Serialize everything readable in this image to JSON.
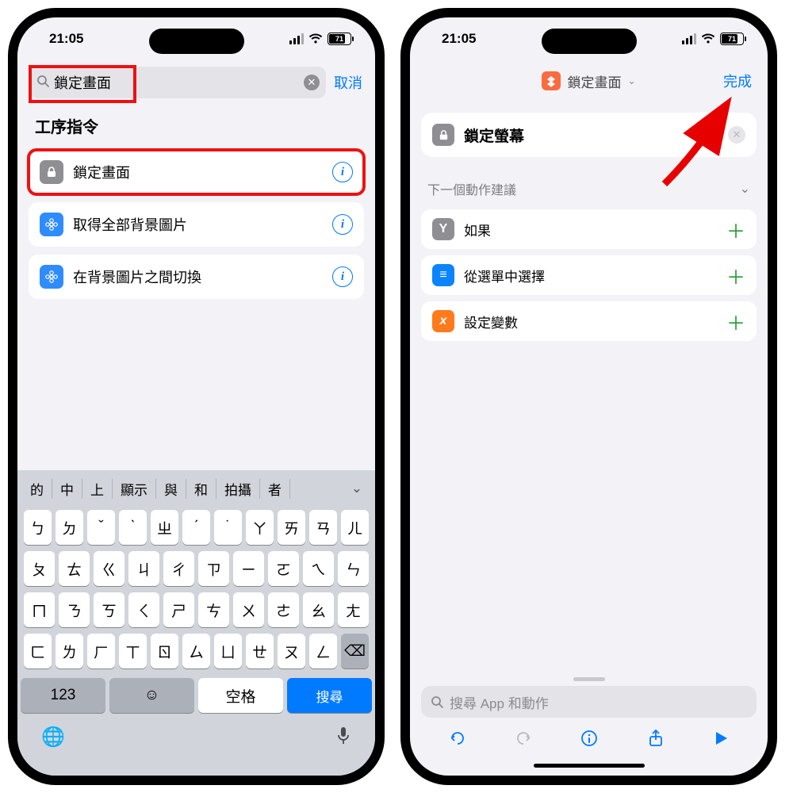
{
  "status": {
    "time": "21:05",
    "battery": "71"
  },
  "left": {
    "search_value": "鎖定畫面",
    "cancel": "取消",
    "section_title": "工序指令",
    "results": [
      {
        "label": "鎖定畫面",
        "icon": "lock-icon",
        "icon_bg": "#8e8e93",
        "highlight": true
      },
      {
        "label": "取得全部背景圖片",
        "icon": "flower-icon",
        "icon_bg": "#2f8cff",
        "highlight": false
      },
      {
        "label": "在背景圖片之間切換",
        "icon": "flower-icon",
        "icon_bg": "#2f8cff",
        "highlight": false
      }
    ],
    "keyboard": {
      "suggestions": [
        "的",
        "中",
        "上",
        "顯示",
        "與",
        "和",
        "拍攝",
        "者"
      ],
      "rows": [
        [
          "ㄅ",
          "ㄉ",
          "ˇ",
          "ˋ",
          "ㄓ",
          "ˊ",
          "˙",
          "ㄚ",
          "ㄞ",
          "ㄢ",
          "ㄦ"
        ],
        [
          "ㄆ",
          "ㄊ",
          "ㄍ",
          "ㄐ",
          "ㄔ",
          "ㄗ",
          "ㄧ",
          "ㄛ",
          "ㄟ",
          "ㄣ"
        ],
        [
          "ㄇ",
          "ㄋ",
          "ㄎ",
          "ㄑ",
          "ㄕ",
          "ㄘ",
          "ㄨ",
          "ㄜ",
          "ㄠ",
          "ㄤ"
        ],
        [
          "ㄈ",
          "ㄌ",
          "ㄏ",
          "ㄒ",
          "ㄖ",
          "ㄙ",
          "ㄩ",
          "ㄝ",
          "ㄡ",
          "ㄥ",
          "⌫"
        ]
      ],
      "key_123": "123",
      "space": "空格",
      "search": "搜尋"
    }
  },
  "right": {
    "title": "鎖定畫面",
    "done": "完成",
    "action_label": "鎖定螢幕",
    "suggestion_header": "下一個動作建議",
    "suggestions": [
      {
        "label": "如果",
        "icon_bg": "#8e8e93",
        "icon_txt": "Y"
      },
      {
        "label": "從選單中選擇",
        "icon_bg": "#0a84ff",
        "icon_txt": "≡"
      },
      {
        "label": "設定變數",
        "icon_bg": "#ff7a1a",
        "icon_txt": "x"
      }
    ],
    "bottom_search_placeholder": "搜尋 App 和動作"
  }
}
